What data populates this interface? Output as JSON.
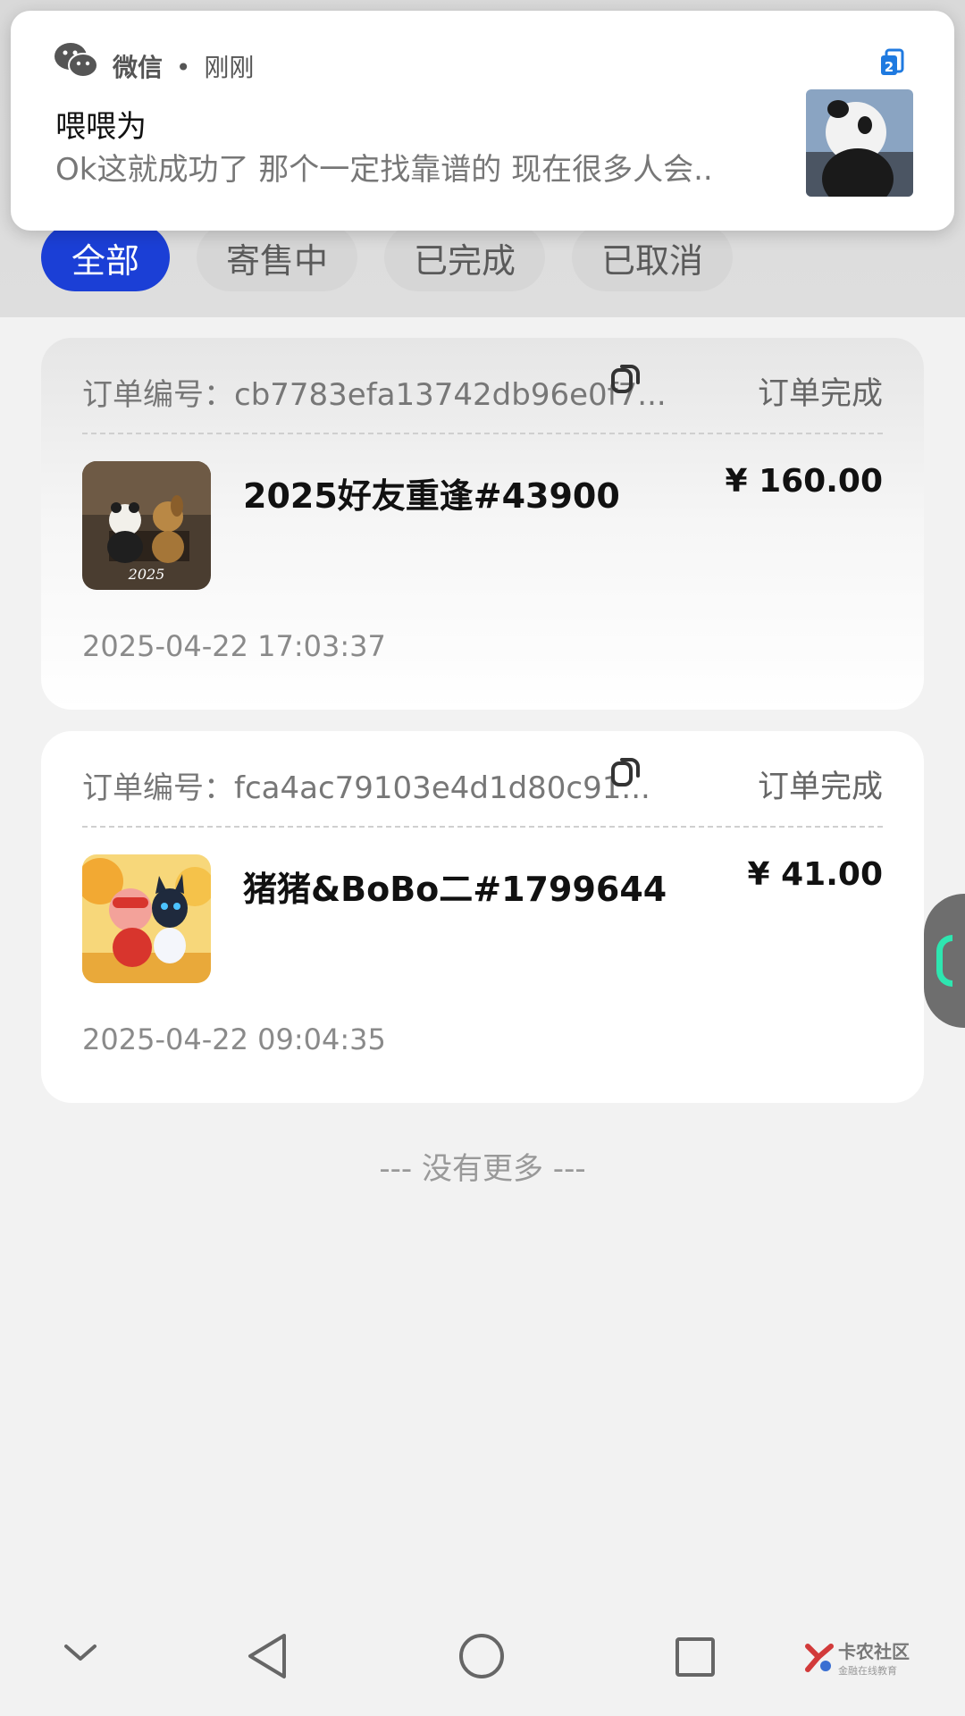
{
  "notification": {
    "app_name": "微信",
    "separator": "•",
    "time": "刚刚",
    "badge_count": "2",
    "title": "喂喂为",
    "body": "Ok这就成功了 那个一定找靠谱的 现在很多人会.."
  },
  "filters": {
    "tabs": [
      {
        "label": "全部",
        "active": true
      },
      {
        "label": "寄售中",
        "active": false
      },
      {
        "label": "已完成",
        "active": false
      },
      {
        "label": "已取消",
        "active": false
      }
    ]
  },
  "orders": [
    {
      "label": "订单编号：",
      "order_id": "cb7783efa13742db96e0f7...",
      "status": "订单完成",
      "item_name": "2025好友重逢#43900",
      "price": "¥ 160.00",
      "time": "2025-04-22 17:03:37",
      "thumb_caption": "2025"
    },
    {
      "label": "订单编号：",
      "order_id": "fca4ac79103e4d1d80c91...",
      "status": "订单完成",
      "item_name": "猪猪&BoBo二#1799644",
      "price": "¥ 41.00",
      "time": "2025-04-22 09:04:35"
    }
  ],
  "list_footer": "--- 没有更多 ---",
  "watermark": {
    "title": "卡农社区",
    "subtitle": "金融在线教育"
  },
  "colors": {
    "accent": "#1b3fd6",
    "chip_bg": "#d6d6d6",
    "float_accent": "#2ee6b0"
  }
}
